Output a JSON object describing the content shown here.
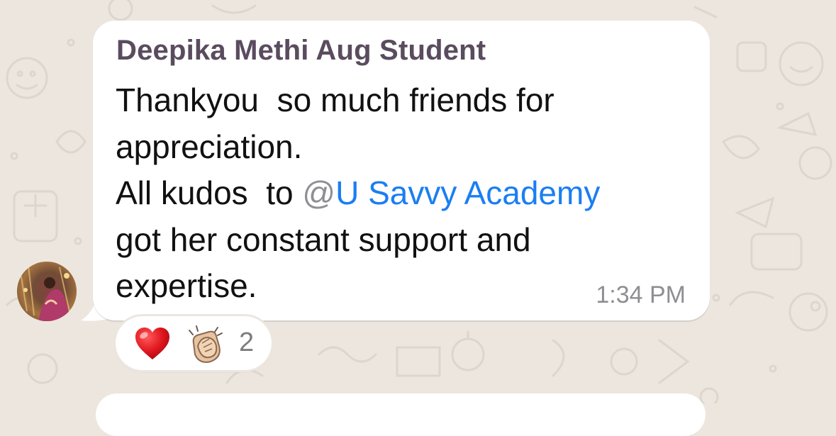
{
  "colors": {
    "wallpaper": "#ece6df",
    "bubble": "#ffffff",
    "sender_name": "#5a4c5e",
    "mention_link": "#1a7ef2",
    "mention_at": "#8e8e93",
    "timestamp": "#8e8e93"
  },
  "message": {
    "sender": "Deepika Methi Aug Student",
    "line1": "Thankyou  so much friends for",
    "line2": "appreciation.",
    "line3_prefix": "All kudos  to ",
    "mention_at": "@",
    "mention_name": "U Savvy Academy",
    "line4": "got her constant support and",
    "line5": "expertise.",
    "time": "1:34 PM"
  },
  "reactions": {
    "icons": [
      "red-heart-icon",
      "clapping-hands-icon"
    ],
    "count": "2"
  }
}
